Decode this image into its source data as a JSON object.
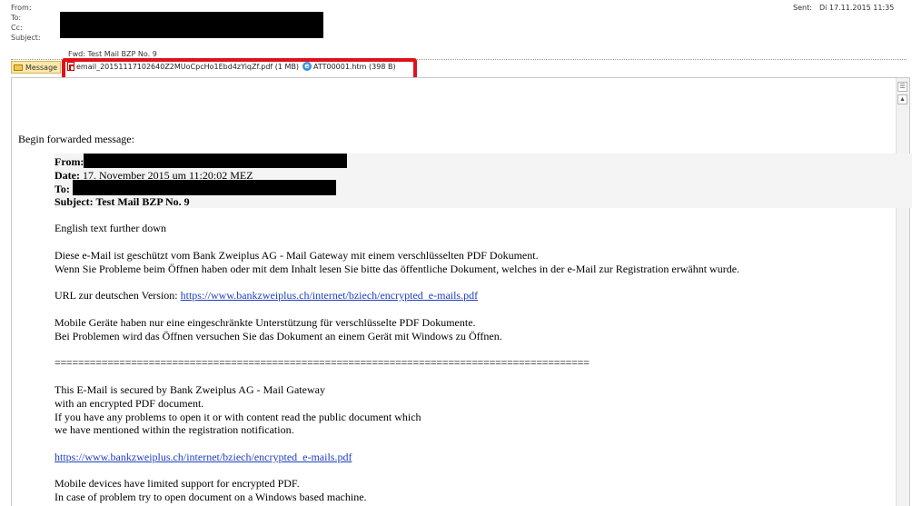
{
  "header": {
    "from_label": "From:",
    "to_label": "To:",
    "cc_label": "Cc:",
    "subject_label": "Subject:",
    "subject_value": "Fwd: Test Mail BZP No. 9",
    "sent_label": "Sent:",
    "sent_value": "Di 17.11.2015 11:35"
  },
  "attachments": {
    "message_tab": "Message",
    "items": [
      {
        "name": "email_20151117102640Z2MUoCpcHo1Ebd4zYiqZf.pdf (1 MB)",
        "icon": "pdf-icon"
      },
      {
        "name": "ATT00001.htm (398 B)",
        "icon": "ie-html-icon"
      }
    ]
  },
  "body": {
    "begin_forwarded": "Begin forwarded message:",
    "fwd": {
      "from_label": "From:",
      "date_label": "Date:",
      "date_value": " 17. November 2015 um 11:20:02 MEZ",
      "to_label": "To:",
      "subject_label": "Subject:",
      "subject_value": " Test Mail BZP No. 9"
    },
    "english_note": "English text further down",
    "de_line1": "Diese e-Mail ist geschützt vom Bank Zweiplus AG - Mail Gateway mit einem verschlüsselten PDF Dokument.",
    "de_line2": "Wenn Sie Probleme beim Öffnen haben oder mit dem Inhalt lesen Sie bitte das öffentliche Dokument, welches in der e-Mail zur Registration erwähnt wurde.",
    "de_url_label": "URL zur deutschen Version: ",
    "de_url": "https://www.bankzweiplus.ch/internet/bziech/encrypted_e-mails.pdf",
    "de_mobile1": "Mobile Geräte haben nur eine eingeschränkte Unterstützung für verschlüsselte PDF Dokumente.",
    "de_mobile2": "Bei Problemen wird das Öffnen versuchen Sie das Dokument an einem Gerät mit Windows zu Öffnen.",
    "divider": "===========================================================================================",
    "en_line1": "This E-Mail is secured by Bank Zweiplus AG - Mail Gateway",
    "en_line2": "with an encrypted PDF document.",
    "en_line3": "If you have any problems to open it or with content read the public document which",
    "en_line4": "we have mentioned within the registration notification.",
    "en_url": "https://www.bankzweiplus.ch/internet/bziech/encrypted_e-mails.pdf",
    "en_mobile1": "Mobile devices have limited support for encrypted PDF.",
    "en_mobile2": "In case of problem try to open document on a Windows based machine."
  },
  "colors": {
    "highlight_box": "#e0101b",
    "link": "#1f3fbf",
    "redaction": "#000000"
  }
}
